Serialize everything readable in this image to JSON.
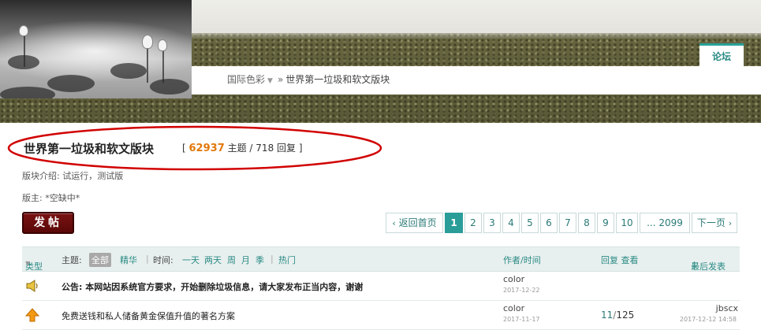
{
  "header": {
    "nav_tab_label": "论坛",
    "breadcrumb": {
      "root": "国际色彩",
      "separator": "»",
      "current": "世界第一垃圾和软文版块"
    }
  },
  "forum": {
    "title": "世界第一垃圾和软文版块",
    "stats_open": "[",
    "threads_count": "62937",
    "threads_word": "主题",
    "slash": "/",
    "replies_count": "718",
    "replies_word": "回复",
    "stats_close": "]",
    "intro_label": "版块介绍:",
    "intro_text": "试运行，测试版",
    "moderator_label": "版主:",
    "moderator_value": "*空缺中*",
    "annotation_color": "#d10000"
  },
  "actions": {
    "new_post": "发帖"
  },
  "pagination": {
    "back_label": "返回首页",
    "pages": [
      "1",
      "2",
      "3",
      "4",
      "5",
      "6",
      "7",
      "8",
      "9",
      "10"
    ],
    "current": "1",
    "last_label": "... 2099",
    "next_label": "下一页"
  },
  "list_header": {
    "type_label": "类型",
    "topic_label": "主题:",
    "filter_all": "全部",
    "filter_digest": "精华",
    "time_label": "时间:",
    "time_day": "一天",
    "time_2days": "两天",
    "time_week": "周",
    "time_month": "月",
    "time_season": "季",
    "hot_label": "热门",
    "author_time": "作者/时间",
    "reply_view": "回复 查看",
    "last_post": "最后发表"
  },
  "threads": [
    {
      "icon": "announcement-speaker-icon",
      "title": "公告: 本网站因系统官方要求，开始删除垃圾信息，请大家发布正当内容，谢谢",
      "author": "color",
      "date": "2017-12-22",
      "replies": "",
      "views": "",
      "last_author": "",
      "last_date": ""
    },
    {
      "icon": "up-arrow-icon",
      "title": "免费送钱和私人储备黄金保值升值的著名方案",
      "author": "color",
      "date": "2017-11-17",
      "replies": "11",
      "views": "125",
      "last_author": "jbscx",
      "last_date": "2017-12-12 14:58"
    }
  ],
  "colors": {
    "accent": "#2aa19a",
    "stats_number": "#e3780a",
    "post_button": "#6a0e0e"
  }
}
